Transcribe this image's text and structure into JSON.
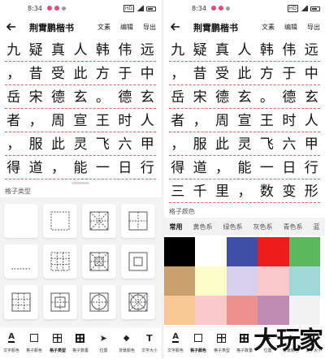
{
  "status": {
    "time": "8:34",
    "badge": "HD"
  },
  "appbar": {
    "title": "荆霄鹏楷书",
    "actions": [
      "文素",
      "编辑",
      "导出"
    ]
  },
  "calligraphy_left": [
    [
      "九",
      "疑",
      "真",
      "人",
      "韩",
      "伟",
      "远"
    ],
    [
      "，",
      "昔",
      "受",
      "此",
      "方",
      "于",
      "中"
    ],
    [
      "岳",
      "宋",
      "德",
      "玄",
      "。",
      "德",
      "玄"
    ],
    [
      "者",
      "，",
      "周",
      "宣",
      "王",
      "时",
      "人"
    ],
    [
      "，",
      "服",
      "此",
      "灵",
      "飞",
      "六",
      "甲"
    ],
    [
      "得",
      "道",
      "，",
      "能",
      "一",
      "日",
      "行"
    ]
  ],
  "calligraphy_right": [
    [
      "九",
      "疑",
      "真",
      "人",
      "韩",
      "伟",
      "远"
    ],
    [
      "，",
      "昔",
      "受",
      "此",
      "方",
      "于",
      "中"
    ],
    [
      "岳",
      "宋",
      "德",
      "玄",
      "。",
      "德",
      "玄"
    ],
    [
      "者",
      "，",
      "周",
      "宣",
      "王",
      "时",
      "人"
    ],
    [
      "，",
      "服",
      "此",
      "灵",
      "飞",
      "六",
      "甲"
    ],
    [
      "得",
      "道",
      "，",
      "能",
      "一",
      "日",
      "行"
    ],
    [
      "三",
      "千",
      "里",
      "，",
      "数",
      "变",
      "形"
    ]
  ],
  "left_panel": {
    "section_label": "格子类型",
    "grid_types": [
      "blank",
      "square-dashed",
      "mi-grid",
      "tian-grid",
      "underline",
      "dot-grid",
      "mi-hui-grid",
      "inner-square",
      "nine-grid",
      "hui-grid",
      "circle-mi",
      "circle-tian"
    ]
  },
  "right_panel": {
    "section_label": "格子颜色",
    "tabs": [
      "常用",
      "黄色系",
      "绿色系",
      "灰色系",
      "青色系",
      "蓝"
    ],
    "active_tab": 0,
    "swatches": [
      "#000000",
      "#ffffff",
      "#3f4fa8",
      "#ee1c1c",
      "#5cb85c",
      "#c8a06e",
      "#fcfcc8",
      "#d6d0ec",
      "#f9c8c8",
      "#9ed8d8",
      "#f9c896",
      "#f9c8c8",
      "#ee9090",
      "#c08cb4",
      "#f2f2f2"
    ]
  },
  "toolbar_left": [
    "文字颜色",
    "格子颜色",
    "格子类型",
    "格子数量",
    "位置",
    "背景颜色",
    "文字大小"
  ],
  "toolbar_right": [
    "文字颜色",
    "格子颜色",
    "格子类型",
    "格子数量",
    "位置",
    "背景颜色",
    "文字大小"
  ],
  "watermark": "大玩家",
  "colors": {
    "grid_line": "#e06060",
    "accent": "#111111"
  }
}
